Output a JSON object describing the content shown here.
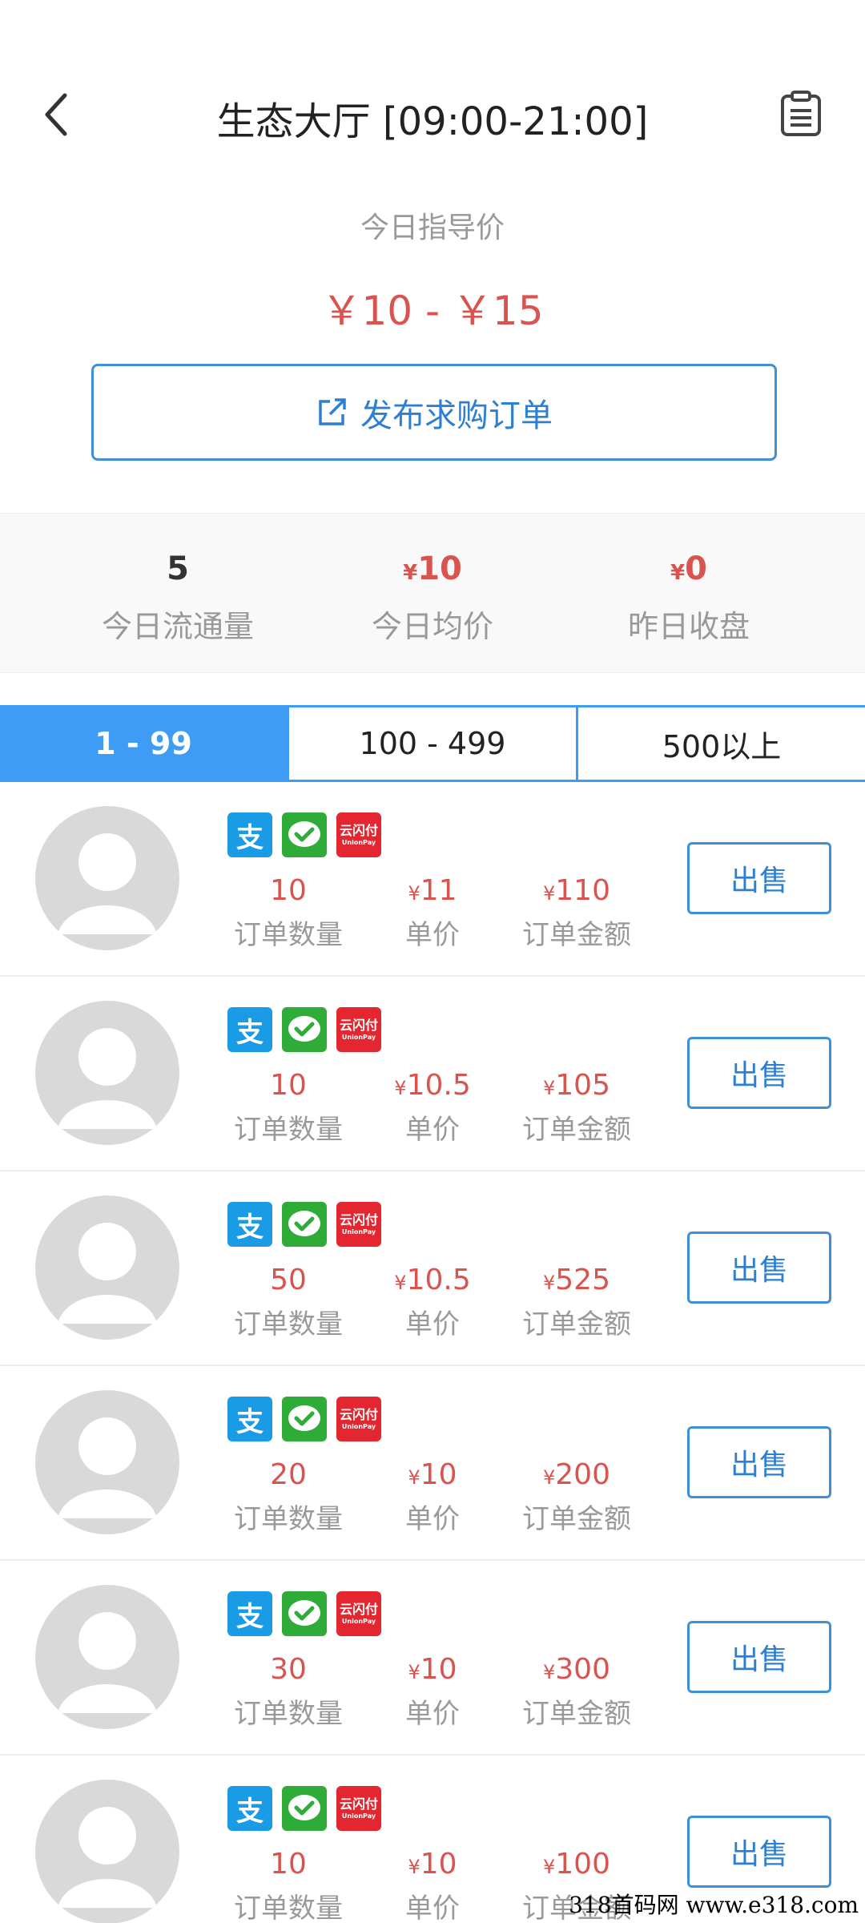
{
  "header": {
    "title": "生态大厅 [09:00-21:00]"
  },
  "guide": {
    "label": "今日指导价",
    "price": "￥10 - ￥15"
  },
  "publish": {
    "label": "发布求购订单"
  },
  "stats": [
    {
      "value": "5",
      "label": "今日流通量",
      "yen": ""
    },
    {
      "value": "10",
      "label": "今日均价",
      "yen": "¥"
    },
    {
      "value": "0",
      "label": "昨日收盘",
      "yen": "¥"
    }
  ],
  "tabs": [
    "1 - 99",
    "100 - 499",
    "500以上"
  ],
  "labels": {
    "qty": "订单数量",
    "unit": "单价",
    "amount": "订单金额",
    "sell": "出售",
    "yen": "¥"
  },
  "orders": [
    {
      "qty": "10",
      "unit": "11",
      "amount": "110"
    },
    {
      "qty": "10",
      "unit": "10.5",
      "amount": "105"
    },
    {
      "qty": "50",
      "unit": "10.5",
      "amount": "525"
    },
    {
      "qty": "20",
      "unit": "10",
      "amount": "200"
    },
    {
      "qty": "30",
      "unit": "10",
      "amount": "300"
    },
    {
      "qty": "10",
      "unit": "10",
      "amount": "100"
    }
  ],
  "payment_icons": {
    "alipay": "支",
    "unionpay_top": "云闪付",
    "unionpay_bottom": "UnionPay"
  },
  "watermark": "318首码网 www.e318.com",
  "colors": {
    "accent": "#3e9cf5",
    "price": "#d9534f"
  }
}
